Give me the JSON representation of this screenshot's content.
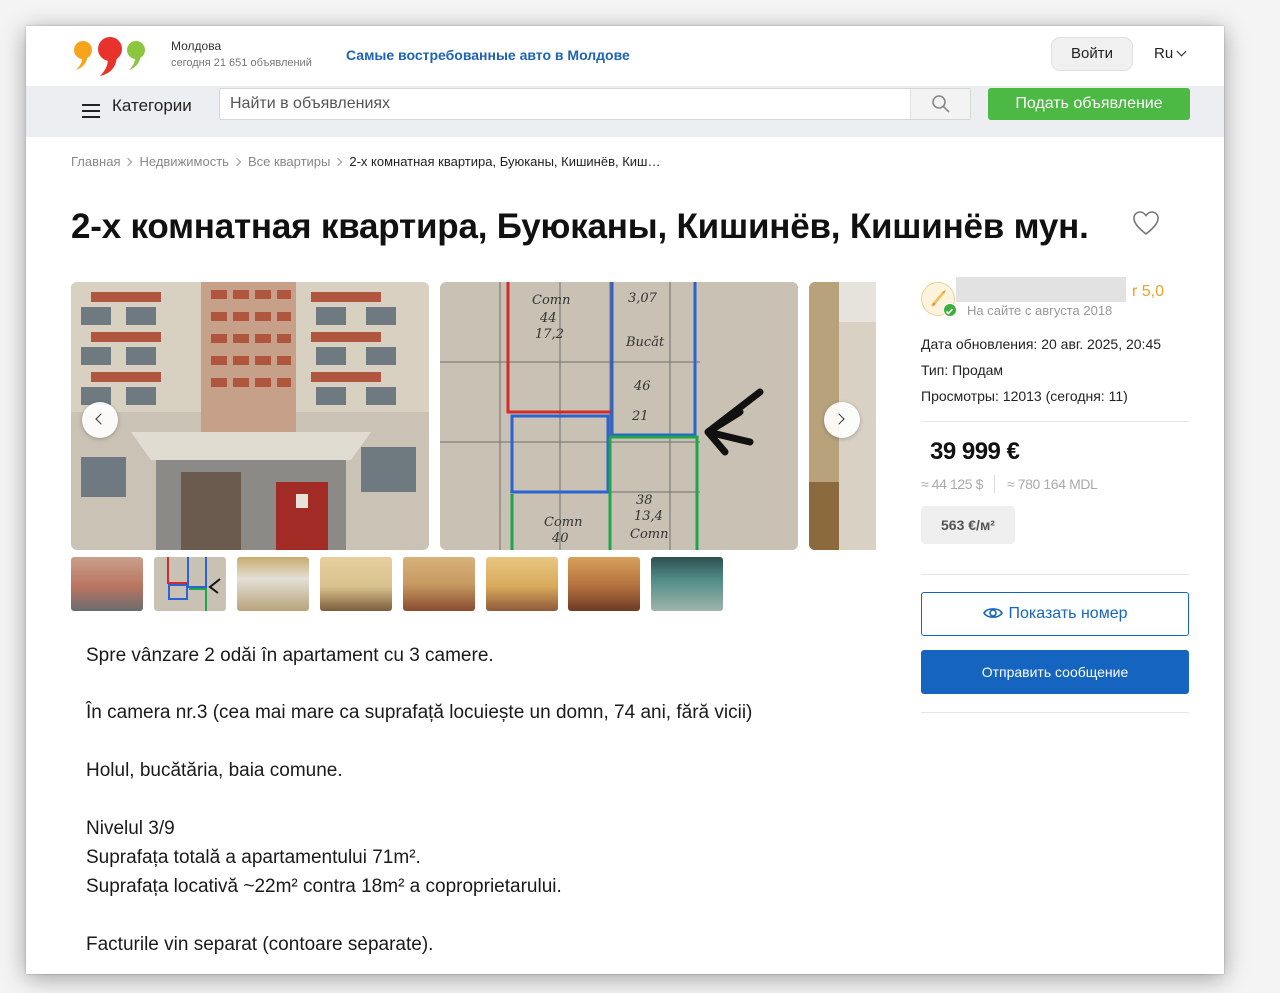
{
  "header": {
    "region": "Молдова",
    "ads_count": "сегодня 21 651 объявлений",
    "promo": "Самые востребованные авто в Молдове",
    "login_label": "Войти",
    "language": "Ru"
  },
  "nav": {
    "categories_label": "Категории",
    "search_placeholder": "Найти в объявлениях",
    "post_ad_label": "Подать объявление"
  },
  "breadcrumb": [
    "Главная",
    "Недвижимость",
    "Все квартиры",
    "2-х комнатная квартира, Буюканы, Кишинёв, Киш…"
  ],
  "listing": {
    "title": "2-х комнатная квартира, Буюканы, Кишинёв, Кишинёв мун.",
    "photo_count": 8
  },
  "seller": {
    "rating": "5,0",
    "since": "На сайте с августа 2018"
  },
  "meta": {
    "updated": "Дата обновления: 20 авг. 2025, 20:45",
    "type": "Тип: Продам",
    "views": "Просмотры: 12013 (сегодня: 11)"
  },
  "price": {
    "main": "39 999 €",
    "usd": "≈ 44 125 $",
    "mdl": "≈ 780 164 MDL",
    "per_m2": "563 €/м²"
  },
  "actions": {
    "show_number": "Показать номер",
    "send_message": "Отправить сообщение"
  },
  "description": [
    "Spre vânzare 2 odăi în apartament cu 3 camere.",
    "În camera nr.3 (cea mai mare ca suprafață locuiește un domn, 74 ani, fără vicii)",
    "Holul, bucătăria, baia comune.",
    "Nivelul 3/9",
    "Suprafața totală a apartamentului 71m².",
    "Suprafața locativă ~22m² contra 18m² a coproprietarului.",
    "Facturile vin separat (contoare separate)."
  ],
  "colors": {
    "green": "#4cb944",
    "blue": "#1565c0",
    "promo_blue": "#1f63b6",
    "rating": "#e8a22b"
  },
  "icons": [
    "burger-icon",
    "search-icon",
    "heart-icon",
    "chevron-down-icon",
    "chevron-left-icon",
    "chevron-right-icon",
    "eye-icon",
    "verified-icon"
  ]
}
